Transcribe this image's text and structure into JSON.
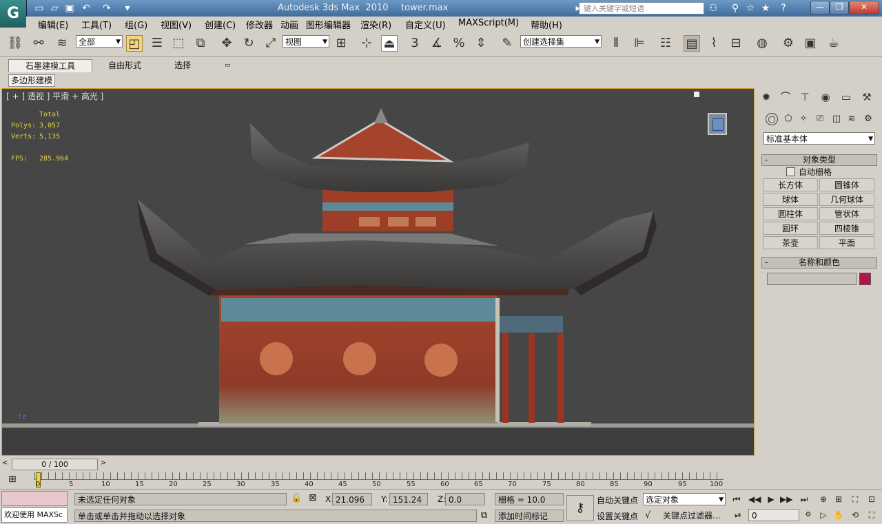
{
  "app": {
    "title": "Autodesk 3ds Max  2010",
    "file": "tower.max",
    "logo_glyph": "G",
    "search_placeholder": "键入关键字或短语",
    "window_buttons": [
      "—",
      "❐",
      "✕"
    ]
  },
  "menu": [
    "编辑(E)",
    "工具(T)",
    "组(G)",
    "视图(V)",
    "创建(C)",
    "修改器",
    "动画",
    "图形编辑器",
    "渲染(R)",
    "自定义(U)",
    "MAXScript(M)",
    "帮助(H)"
  ],
  "toolbar": {
    "selection_filter": "全部",
    "reference_coord": "视图",
    "named_selection": "创建选择集",
    "snap_labels": [
      "3",
      "%"
    ]
  },
  "ribbon": {
    "tabs": [
      "石墨建模工具",
      "自由形式",
      "选择"
    ],
    "subtab": "多边形建模"
  },
  "viewport": {
    "label": "[ + ] 透视 ] 平滑 + 高光 ]",
    "stats": {
      "header": "Total",
      "polys_label": "Polys:",
      "polys": "3,057",
      "verts_label": "Verts:",
      "verts": "5,135",
      "fps_label": "FPS:",
      "fps": "285.964"
    }
  },
  "command_panel": {
    "category": "标准基本体",
    "object_type_title": "对象类型",
    "autogrid": "自动栅格",
    "objects": [
      "长方体",
      "圆锥体",
      "球体",
      "几何球体",
      "圆柱体",
      "管状体",
      "圆环",
      "四棱锥",
      "茶壶",
      "平面"
    ],
    "name_color_title": "名称和颜色",
    "object_color": "#b0164a"
  },
  "timeline": {
    "frame_display": "0 / 100",
    "ticks": [
      "0",
      "5",
      "10",
      "15",
      "20",
      "25",
      "30",
      "35",
      "40",
      "45",
      "50",
      "55",
      "60",
      "65",
      "70",
      "75",
      "80",
      "85",
      "90",
      "95",
      "100"
    ]
  },
  "status": {
    "maxscript": "欢迎使用 MAXSc",
    "prompt1": "未选定任何对象",
    "prompt2": "单击或单击并拖动以选择对象",
    "x_label": "X:",
    "x_value": "21.096",
    "y_label": "Y:",
    "y_value": "151.24",
    "z_label": "Z:",
    "z_value": "0.0",
    "grid": "栅格 = 10.0",
    "add_time_tag": "添加时间标记",
    "auto_key": "自动关键点",
    "set_key": "设置关键点",
    "selected_object": "选定对象",
    "key_filters": "关键点过滤器...",
    "current_frame": "0"
  }
}
